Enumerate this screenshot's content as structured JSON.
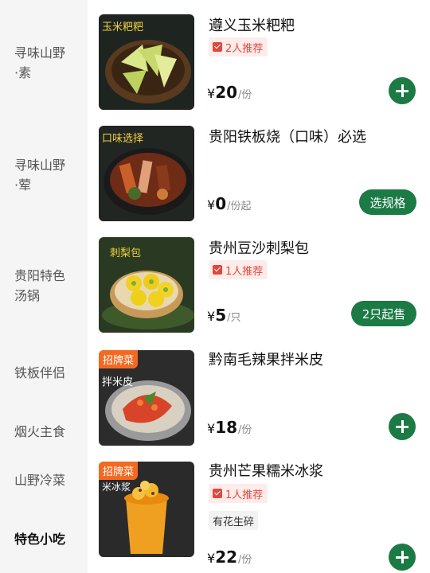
{
  "categories": [
    {
      "label_line1": "寻味山野",
      "label_line2": "·素",
      "active": false
    },
    {
      "label_line1": "寻味山野",
      "label_line2": "·荤",
      "active": false
    },
    {
      "label_line1": "贵阳特色",
      "label_line2": "汤锅",
      "active": false
    },
    {
      "label_line1": "铁板伴侣",
      "label_line2": "",
      "active": false
    },
    {
      "label_line1": "烟火主食",
      "label_line2": "",
      "active": false
    },
    {
      "label_line1": "山野冷菜",
      "label_line2": "",
      "active": false
    },
    {
      "label_line1": "特色小吃",
      "label_line2": "",
      "active": true
    }
  ],
  "items": [
    {
      "name": "遵义玉米粑粑",
      "recommend": "2人推荐",
      "price_symbol": "¥",
      "price": "20",
      "unit": "/份",
      "action": "add",
      "image_text": "玉米粑粑"
    },
    {
      "name": "贵阳铁板烧（口味）必选",
      "price_symbol": "¥",
      "price": "0",
      "unit": "/份起",
      "action_label": "选规格",
      "image_text": "口味选择"
    },
    {
      "name": "贵州豆沙刺梨包",
      "recommend": "1人推荐",
      "price_symbol": "¥",
      "price": "5",
      "unit": "/只",
      "action_label": "2只起售",
      "image_text": "刺梨包"
    },
    {
      "name": "黔南毛辣果拌米皮",
      "badge": "招牌菜",
      "price_symbol": "¥",
      "price": "18",
      "unit": "/份",
      "action": "add",
      "image_text": "拌米皮"
    },
    {
      "name": "贵州芒果糯米冰浆",
      "badge": "招牌菜",
      "recommend": "1人推荐",
      "tag": "有花生碎",
      "price_symbol": "¥",
      "price": "22",
      "unit": "/份",
      "action": "add",
      "image_text": "米冰浆"
    }
  ],
  "colors": {
    "brand_green": "#1c7a45",
    "badge_orange": "#f26a21",
    "recommend_red": "#e0483c"
  }
}
